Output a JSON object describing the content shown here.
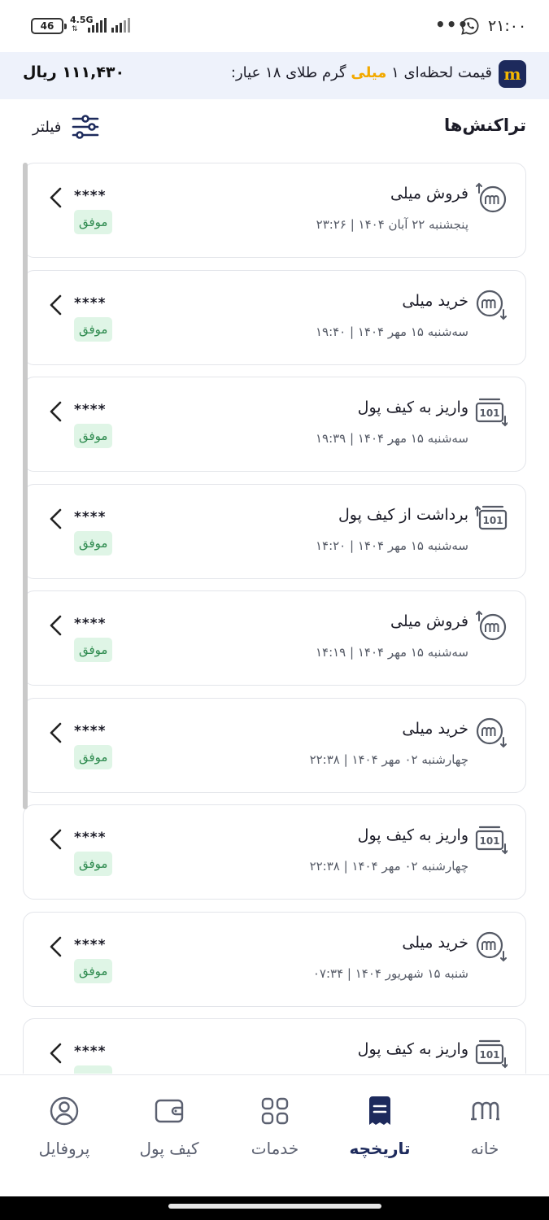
{
  "status_bar": {
    "time": "۲۱:۰۰",
    "battery": "46",
    "network": "4.5G",
    "dots": "•••"
  },
  "price_bar": {
    "logo": "m",
    "title_prefix": "قیمت لحظه‌ای ۱",
    "title_highlight": "میلی",
    "title_suffix": "گرم طلای ۱۸ عیار:",
    "value": "۱۱۱,۴۳۰ ریال",
    "highlight_color": "#f2a900"
  },
  "page": {
    "title": "تراکنش‌ها",
    "filter_label": "فیلتر"
  },
  "transactions": [
    {
      "title": "فروش میلی",
      "date": "پنجشنبه ۲۲ آبان ۱۴۰۴ | ۲۳:۲۶",
      "amount": "****",
      "status": "موفق",
      "icon": "milli-sell-icon"
    },
    {
      "title": "خرید میلی",
      "date": "سه‌شنبه ۱۵ مهر ۱۴۰۴ | ۱۹:۴۰",
      "amount": "****",
      "status": "موفق",
      "icon": "milli-buy-icon"
    },
    {
      "title": "واریز به کیف پول",
      "date": "سه‌شنبه ۱۵ مهر ۱۴۰۴ | ۱۹:۳۹",
      "amount": "****",
      "status": "موفق",
      "icon": "wallet-deposit-icon"
    },
    {
      "title": "برداشت از کیف پول",
      "date": "سه‌شنبه ۱۵ مهر ۱۴۰۴ | ۱۴:۲۰",
      "amount": "****",
      "status": "موفق",
      "icon": "wallet-withdraw-icon"
    },
    {
      "title": "فروش میلی",
      "date": "سه‌شنبه ۱۵ مهر ۱۴۰۴ | ۱۴:۱۹",
      "amount": "****",
      "status": "موفق",
      "icon": "milli-sell-icon"
    },
    {
      "title": "خرید میلی",
      "date": "چهارشنبه ۰۲ مهر ۱۴۰۴ | ۲۲:۳۸",
      "amount": "****",
      "status": "موفق",
      "icon": "milli-buy-icon"
    },
    {
      "title": "واریز به کیف پول",
      "date": "چهارشنبه ۰۲ مهر ۱۴۰۴ | ۲۲:۳۸",
      "amount": "****",
      "status": "موفق",
      "icon": "wallet-deposit-icon"
    },
    {
      "title": "خرید میلی",
      "date": "شنبه ۱۵ شهریور ۱۴۰۴ | ۰۷:۳۴",
      "amount": "****",
      "status": "موفق",
      "icon": "milli-buy-icon"
    },
    {
      "title": "واریز به کیف پول",
      "date": "",
      "amount": "****",
      "status": "موفق",
      "icon": "wallet-deposit-icon"
    }
  ],
  "bottom_nav": [
    {
      "label": "خانه",
      "icon": "home-logo-icon",
      "active": false
    },
    {
      "label": "تاریخچه",
      "icon": "history-icon",
      "active": true
    },
    {
      "label": "خدمات",
      "icon": "services-grid-icon",
      "active": false
    },
    {
      "label": "کیف پول",
      "icon": "wallet-icon",
      "active": false
    },
    {
      "label": "پروفایل",
      "icon": "profile-icon",
      "active": false
    }
  ],
  "colors": {
    "brand_navy": "#1d2a5c",
    "brand_gold": "#f5b800",
    "success_bg": "#dff5e6",
    "success_text": "#2d8a4e"
  }
}
